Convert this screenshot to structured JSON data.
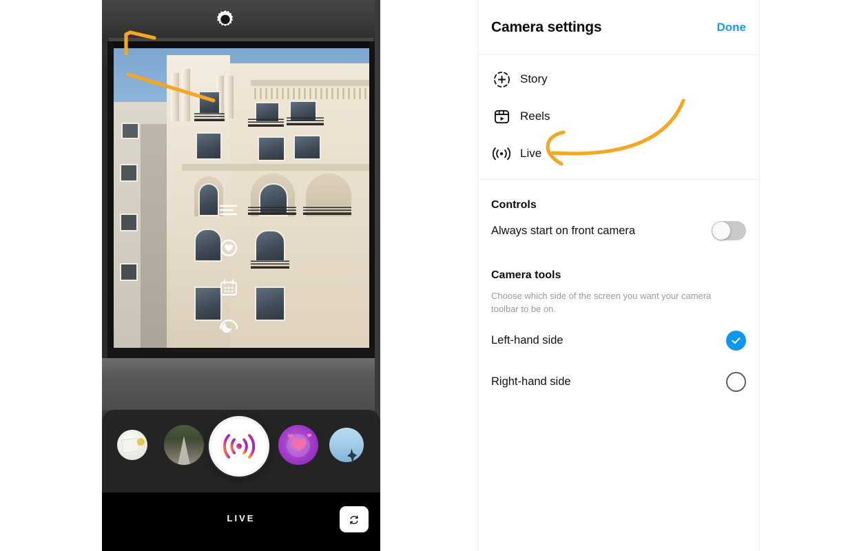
{
  "camera": {
    "gear_icon": "settings-gear-icon",
    "close_icon": "close-icon",
    "tools": [
      {
        "name": "effects-lines-icon",
        "label": "Effects"
      },
      {
        "name": "favorites-heart-icon",
        "label": "Favorites"
      },
      {
        "name": "calendar-icon",
        "label": "Schedule"
      },
      {
        "name": "moon-timer-icon",
        "label": "Timer"
      }
    ],
    "carousel": [
      {
        "name": "effect-thumb-desk",
        "label": "Desk effect"
      },
      {
        "name": "effect-thumb-forest",
        "label": "Forest effect"
      },
      {
        "name": "live-capture-button",
        "label": "Go live"
      },
      {
        "name": "effect-thumb-hearts",
        "label": "Hearts effect"
      },
      {
        "name": "effect-thumb-sky",
        "label": "Sky effect"
      }
    ],
    "mode_label": "LIVE",
    "flip_icon": "camera-flip-icon"
  },
  "settings": {
    "title": "Camera settings",
    "done_label": "Done",
    "modes": [
      {
        "label": "Story",
        "icon": "story-plus-icon"
      },
      {
        "label": "Reels",
        "icon": "reels-clapper-icon"
      },
      {
        "label": "Live",
        "icon": "live-broadcast-icon"
      }
    ],
    "controls": {
      "heading": "Controls",
      "front_camera_label": "Always start on front camera",
      "front_camera_state": "off"
    },
    "camera_tools": {
      "heading": "Camera tools",
      "description": "Choose which side of the screen you want your camera toolbar to be on.",
      "options": [
        {
          "label": "Left-hand side",
          "selected": true
        },
        {
          "label": "Right-hand side",
          "selected": false
        }
      ]
    }
  },
  "colors": {
    "accent_blue": "#0e96ec",
    "done_blue": "#1a9bf0",
    "annotation_orange": "#f5a623",
    "panel_bg": "#ffffff",
    "tray_bg": "#242424"
  },
  "annotations": [
    {
      "name": "arrow-to-gear",
      "target": "settings-gear-icon",
      "color": "#f5a623"
    },
    {
      "name": "arrow-to-live-mode",
      "target": "live-mode-row",
      "color": "#f5a623"
    }
  ]
}
